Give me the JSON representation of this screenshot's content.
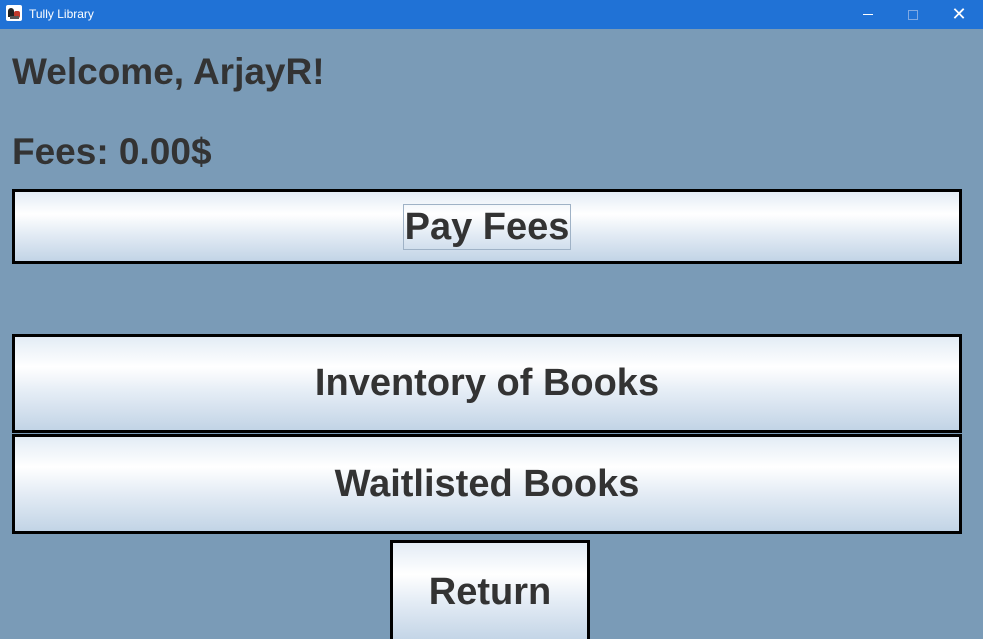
{
  "window": {
    "title": "Tully Library",
    "icons": {
      "app": "app-icon",
      "minimize": "minimize-icon",
      "maximize": "maximize-icon",
      "close": "close-icon"
    },
    "colors": {
      "titlebar": "#2072d6",
      "background": "#7a9bb7",
      "text": "#333333"
    }
  },
  "main": {
    "welcome_text": "Welcome, ArjayR!",
    "fees_text": "Fees: 0.00$",
    "pay_fees_label": "Pay Fees",
    "inventory_label": "Inventory of Books",
    "waitlisted_label": "Waitlisted Books",
    "return_label": "Return"
  }
}
